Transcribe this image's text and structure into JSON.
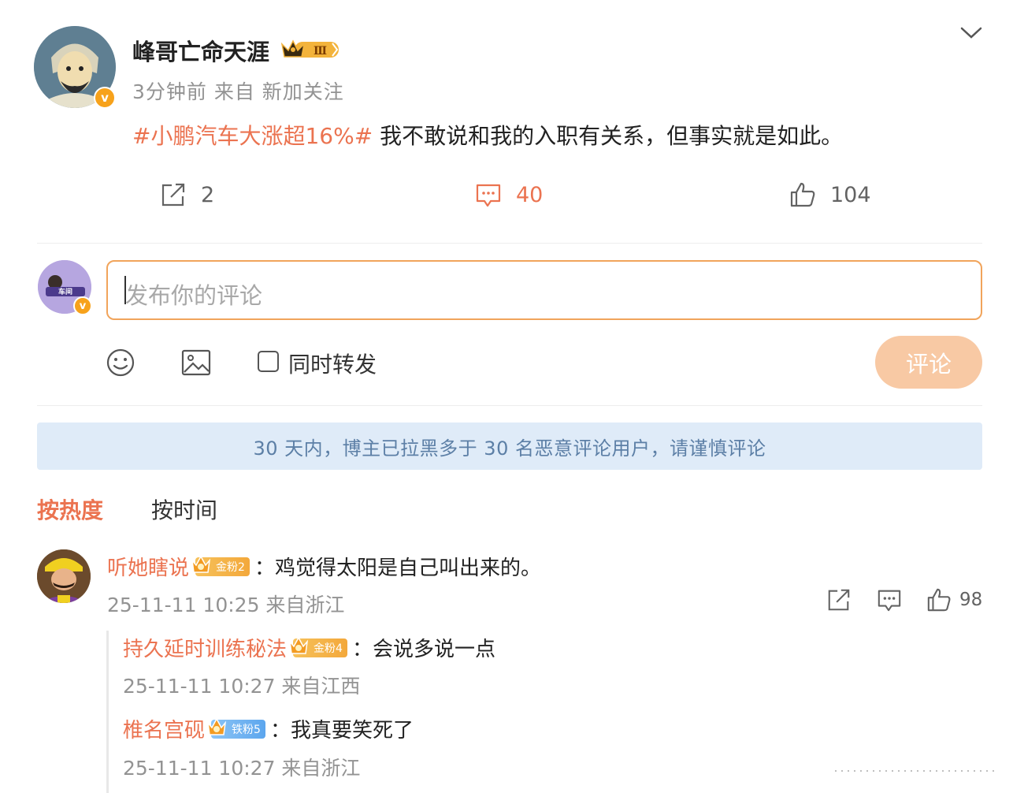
{
  "post": {
    "username": "峰哥亡命天涯",
    "vip_level": "Ⅲ",
    "meta": "3分钟前  来自 新加关注",
    "hashtag": "#小鹏汽车大涨超16%#",
    "text": " 我不敢说和我的入职有关系，但事实就是如此。",
    "actions": {
      "repost_count": "2",
      "comment_count": "40",
      "like_count": "104"
    }
  },
  "composer": {
    "placeholder": "发布你的评论",
    "also_repost_label": "同时转发",
    "submit_label": "评论"
  },
  "notice": "30 天内，博主已拉黑多于 30 名恶意评论用户，请谨慎评论",
  "sort": {
    "hot": "按热度",
    "time": "按时间"
  },
  "comments": [
    {
      "name": "听她瞎说",
      "badge": "金粉2",
      "text": "：鸡觉得太阳是自己叫出来的。",
      "meta": "25-11-11 10:25 来自浙江",
      "like_count": "98",
      "replies": [
        {
          "name": "持久延时训练秘法",
          "badge": "金粉4",
          "text": "：会说多说一点",
          "meta": "25-11-11 10:27 来自江西"
        },
        {
          "name": "椎名宫砚",
          "badge": "铁粉5",
          "text": "：我真要笑死了",
          "meta": "25-11-11 10:27 来自浙江"
        }
      ]
    }
  ],
  "colors": {
    "accent": "#eb7350",
    "notice_bg": "#dfebf8",
    "notice_text": "#5c7fa6",
    "button_disabled": "#f8c9a4"
  }
}
